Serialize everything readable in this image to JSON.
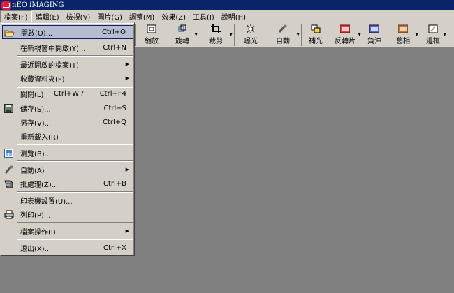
{
  "window": {
    "title": "nEO iMAGING"
  },
  "menubar": {
    "items": [
      {
        "label": "檔案(F)"
      },
      {
        "label": "編輯(E)"
      },
      {
        "label": "檢視(V)"
      },
      {
        "label": "圖片(G)"
      },
      {
        "label": "調整(M)"
      },
      {
        "label": "效果(Z)"
      },
      {
        "label": "工具(I)"
      },
      {
        "label": "說明(H)"
      }
    ]
  },
  "toolbar": {
    "items": [
      {
        "label": "縮放",
        "icon": "zoom-icon"
      },
      {
        "label": "旋轉",
        "icon": "rotate-icon"
      },
      {
        "label": "裁剪",
        "icon": "crop-icon"
      },
      {
        "label": "曝光",
        "icon": "exposure-icon"
      },
      {
        "label": "自動",
        "icon": "auto-icon"
      },
      {
        "label": "補光",
        "icon": "fill-light-icon"
      },
      {
        "label": "反轉片",
        "icon": "reversal-film-icon"
      },
      {
        "label": "負沖",
        "icon": "cross-process-icon"
      },
      {
        "label": "舊相",
        "icon": "old-photo-icon"
      },
      {
        "label": "邊框",
        "icon": "frame-icon"
      }
    ]
  },
  "file_menu": {
    "items": [
      {
        "label": "開啟(O)...",
        "shortcut": "Ctrl+O",
        "icon": "open-folder-icon"
      },
      {
        "label": "在新視窗中開啟(Y)...",
        "shortcut": "Ctrl+N"
      },
      {
        "label": "最近開啟的檔案(T)"
      },
      {
        "label": "收藏資料夾(F)"
      },
      {
        "label": "關閉(L)",
        "mid": "Ctrl+W  /",
        "shortcut": "Ctrl+F4"
      },
      {
        "label": "儲存(S)...",
        "shortcut": "Ctrl+S",
        "icon": "save-icon"
      },
      {
        "label": "另存(V)...",
        "shortcut": "Ctrl+Q"
      },
      {
        "label": "重新載入(R)"
      },
      {
        "label": "瀏覽(B)...",
        "icon": "browse-icon"
      },
      {
        "label": "自動(A)",
        "icon": "auto-icon"
      },
      {
        "label": "批處理(Z)...",
        "shortcut": "Ctrl+B",
        "icon": "batch-icon"
      },
      {
        "label": "印表機設置(U)..."
      },
      {
        "label": "列印(P)...",
        "icon": "printer-icon"
      },
      {
        "label": "檔案操作(I)"
      },
      {
        "label": "退出(X)...",
        "shortcut": "Ctrl+X"
      }
    ]
  }
}
